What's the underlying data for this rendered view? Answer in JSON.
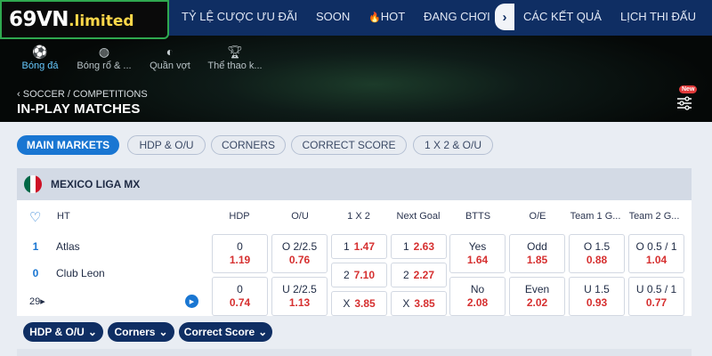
{
  "brand": {
    "logo": "69VN",
    "logo_domain": ".limited"
  },
  "nav": {
    "items": [
      "TỶ LỆ CƯỢC ƯU ĐÃI",
      "SOON",
      "HOT",
      "ĐANG CHƠI",
      "CÁC KẾT QUẢ",
      "LỊCH THI ĐẤU"
    ]
  },
  "sports": [
    {
      "label": "Bóng đá",
      "icon": "soccer-ball-icon",
      "active": true
    },
    {
      "label": "Bóng rổ & ...",
      "icon": "basketball-icon",
      "active": false
    },
    {
      "label": "Quần vợt",
      "icon": "tennis-ball-icon",
      "active": false
    },
    {
      "label": "Thể thao k...",
      "icon": "trophy-icon",
      "active": false
    }
  ],
  "breadcrumb": "SOCCER / COMPETITIONS",
  "page_title": "IN-PLAY MATCHES",
  "filter_badge": "New",
  "market_tabs": [
    "MAIN MARKETS",
    "HDP & O/U",
    "CORNERS",
    "CORRECT SCORE",
    "1 X 2 & O/U"
  ],
  "league": {
    "name": "MEXICO LIGA MX",
    "flag_colors": [
      "#006847",
      "#ffffff",
      "#ce1126"
    ]
  },
  "columns": {
    "ht": "HT",
    "hdp": "HDP",
    "ou": "O/U",
    "x12": "1 X 2",
    "next_goal": "Next Goal",
    "btts": "BTTS",
    "oe": "O/E",
    "team1g": "Team 1 G...",
    "team2g": "Team 2 G..."
  },
  "match": {
    "home": {
      "score": "1",
      "name": "Atlas"
    },
    "away": {
      "score": "0",
      "name": "Club Leon"
    },
    "more_markets": "29"
  },
  "odds": {
    "hdp": [
      {
        "label": "0",
        "value": "1.19"
      },
      {
        "label": "0",
        "value": "0.74"
      }
    ],
    "ou": [
      {
        "label": "O 2/2.5",
        "value": "0.76"
      },
      {
        "label": "U 2/2.5",
        "value": "1.13"
      }
    ],
    "x12": [
      {
        "label": "1",
        "value": "1.47"
      },
      {
        "label": "2",
        "value": "7.10"
      },
      {
        "label": "X",
        "value": "3.85"
      }
    ],
    "next_goal": [
      {
        "label": "1",
        "value": "2.63"
      },
      {
        "label": "2",
        "value": "2.27"
      },
      {
        "label": "X",
        "value": "3.85"
      }
    ],
    "btts": [
      {
        "label": "Yes",
        "value": "1.64"
      },
      {
        "label": "No",
        "value": "2.08"
      }
    ],
    "oe": [
      {
        "label": "Odd",
        "value": "1.85"
      },
      {
        "label": "Even",
        "value": "2.02"
      }
    ],
    "team1g": [
      {
        "label": "O 1.5",
        "value": "0.88"
      },
      {
        "label": "U 1.5",
        "value": "0.93"
      }
    ],
    "team2g": [
      {
        "label": "O 0.5 / 1",
        "value": "1.04"
      },
      {
        "label": "U 0.5 / 1",
        "value": "0.77"
      }
    ]
  },
  "bottom_pills": [
    "HDP & O/U",
    "Corners",
    "Correct Score"
  ],
  "colors": {
    "accent": "#1976d2",
    "nav": "#0f2e63",
    "odds_value": "#d63030",
    "logo_border": "#2fa84f"
  }
}
